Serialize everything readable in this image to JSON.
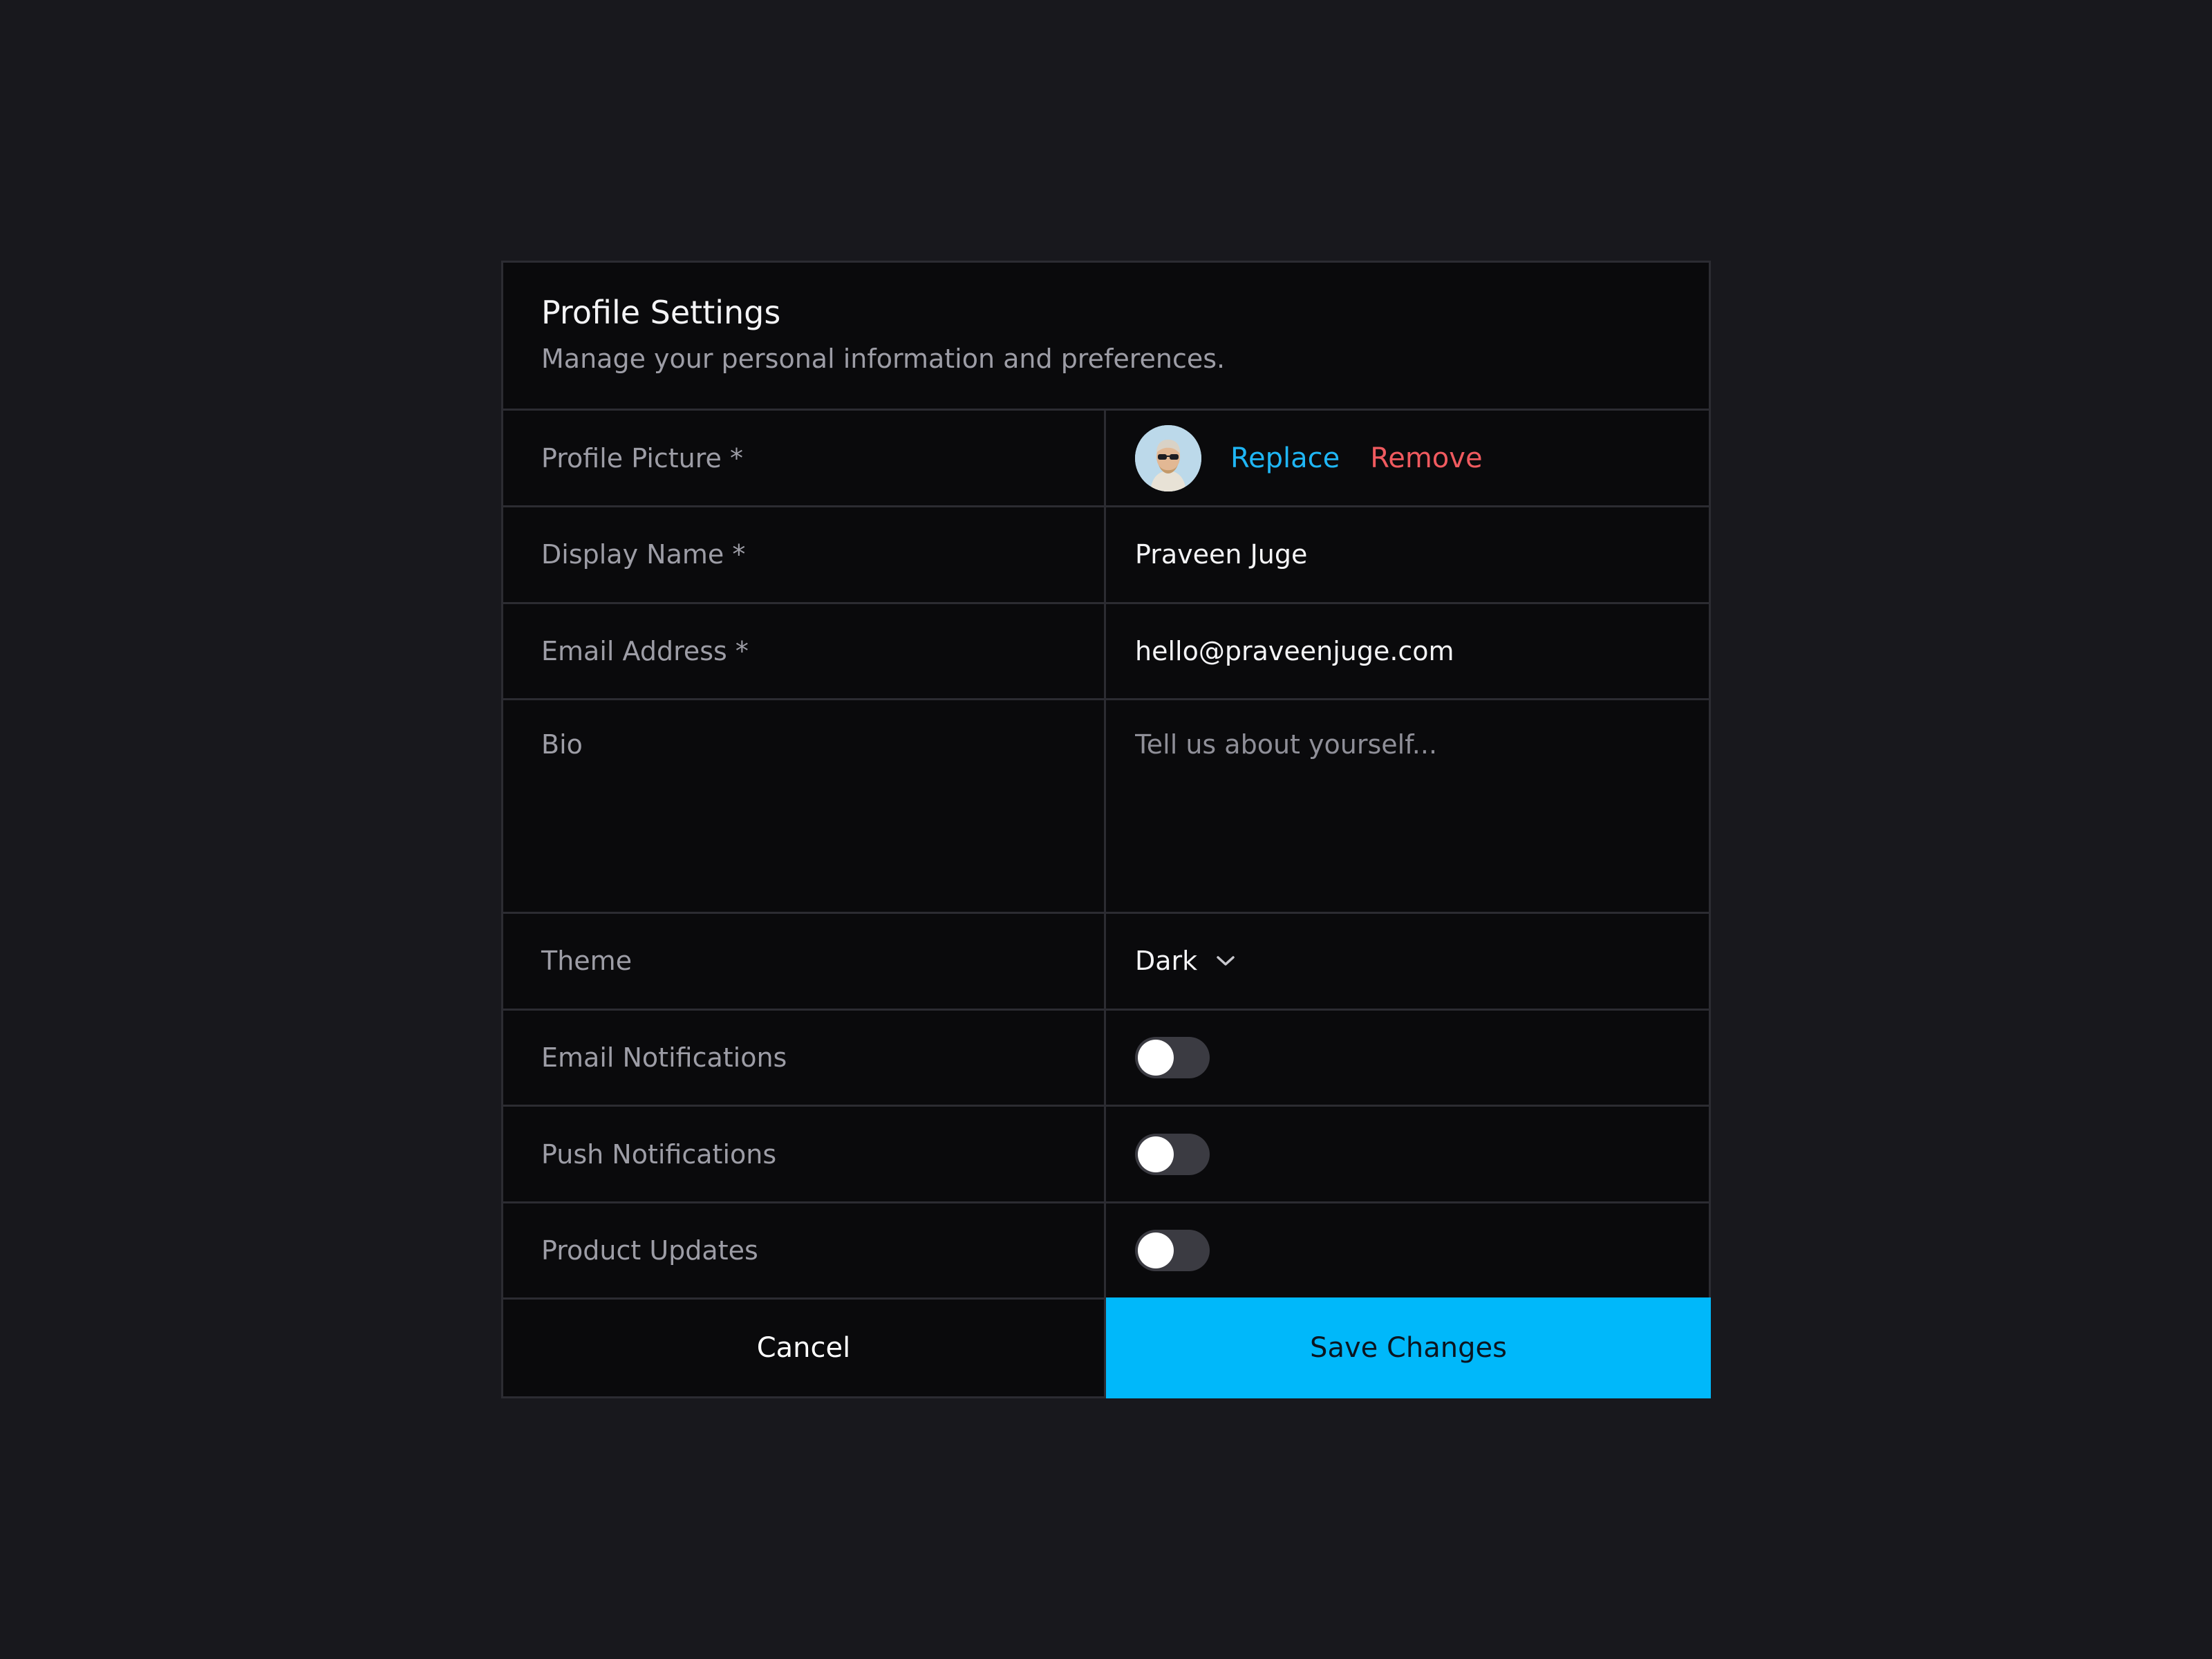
{
  "header": {
    "title": "Profile Settings",
    "subtitle": "Manage your personal information and preferences."
  },
  "fields": {
    "profile_picture": {
      "label": "Profile Picture *",
      "replace_label": "Replace",
      "remove_label": "Remove"
    },
    "display_name": {
      "label": "Display Name *",
      "value": "Praveen Juge"
    },
    "email": {
      "label": "Email Address *",
      "value": "hello@praveenjuge.com"
    },
    "bio": {
      "label": "Bio",
      "placeholder": "Tell us about yourself..."
    },
    "theme": {
      "label": "Theme",
      "selected": "Dark"
    },
    "email_notifications": {
      "label": "Email Notifications",
      "enabled": false
    },
    "push_notifications": {
      "label": "Push Notifications",
      "enabled": false
    },
    "product_updates": {
      "label": "Product Updates",
      "enabled": false
    }
  },
  "actions": {
    "cancel_label": "Cancel",
    "save_label": "Save Changes"
  },
  "colors": {
    "accent": "#00b8fa",
    "link": "#1fb6f5",
    "danger": "#f05a5f",
    "background": "#18181d",
    "card": "#0a0a0c"
  },
  "icons": [
    "avatar-image",
    "chevron-down-icon"
  ]
}
